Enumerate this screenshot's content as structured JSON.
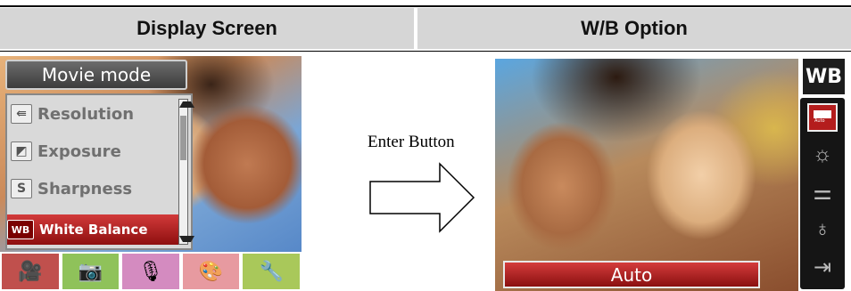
{
  "headers": {
    "left": "Display Screen",
    "right": "W/B Option"
  },
  "left_screen": {
    "mode_title": "Movie mode",
    "menu_items": [
      {
        "label": "Resolution",
        "icon": "resolution-icon",
        "glyph": "⇚"
      },
      {
        "label": "Exposure",
        "icon": "exposure-icon",
        "glyph": "◩"
      },
      {
        "label": "Sharpness",
        "icon": "sharpness-icon",
        "glyph": "S"
      },
      {
        "label": "White Balance",
        "icon": "white-balance-icon",
        "glyph": "WB"
      }
    ],
    "selected_menu_item": "White Balance",
    "tabs": [
      {
        "icon": "movie-camera-icon",
        "glyph": "🎥",
        "color": "#c0504d"
      },
      {
        "icon": "camera-icon",
        "glyph": "📷",
        "color": "#8fc25a"
      },
      {
        "icon": "microphone-icon",
        "glyph": "🎙",
        "color": "#d48bc0"
      },
      {
        "icon": "palette-icon",
        "glyph": "🎨",
        "color": "#e79aa0"
      },
      {
        "icon": "tools-icon",
        "glyph": "🔧",
        "color": "#a9c85a"
      }
    ]
  },
  "middle": {
    "instruction": "Enter Button"
  },
  "right_screen": {
    "badge": "WB",
    "current_value": "Auto",
    "options": [
      {
        "icon": "wb-auto-icon",
        "glyph": "Auto"
      },
      {
        "icon": "sun-icon",
        "glyph": "☼"
      },
      {
        "icon": "fluorescent-icon",
        "glyph": "⚌"
      },
      {
        "icon": "bulb-icon",
        "glyph": "♁"
      },
      {
        "icon": "exit-icon",
        "glyph": "⇥"
      }
    ]
  },
  "colors": {
    "header_bg": "#d6d6d6",
    "selection_red": "#b41d1d"
  }
}
